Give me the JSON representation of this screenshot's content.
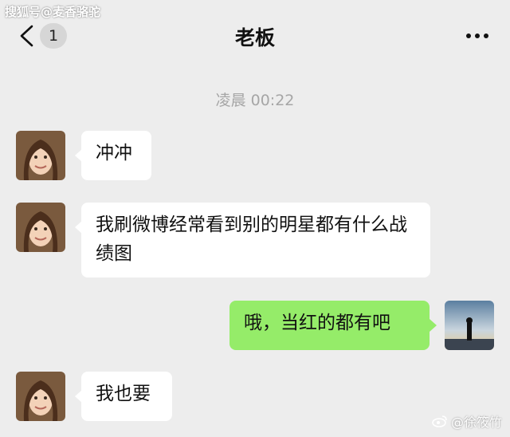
{
  "watermark_top": "搜狐号@麦香骆驼",
  "header": {
    "unread_count": "1",
    "title": "老板"
  },
  "timestamp": "凌晨 00:22",
  "messages": [
    {
      "side": "left",
      "text": "冲冲"
    },
    {
      "side": "left",
      "text": "我刷微博经常看到别的明星都有什么战绩图"
    },
    {
      "side": "right",
      "text": "哦，当红的都有吧"
    },
    {
      "side": "left",
      "text": "我也要"
    }
  ],
  "watermark_bottom": "@徐筱竹",
  "colors": {
    "background": "#ededed",
    "sent_bubble": "#95ec69",
    "received_bubble": "#ffffff",
    "timestamp": "#a6a6a6"
  },
  "icons": {
    "back": "chevron-left-icon",
    "more": "more-horizontal-icon",
    "weibo": "weibo-logo-icon"
  }
}
